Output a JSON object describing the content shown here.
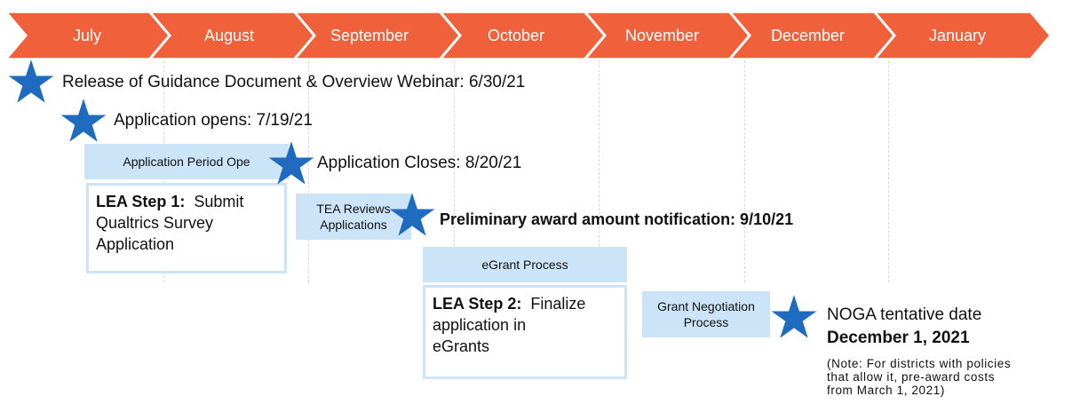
{
  "timeline": {
    "color": "#f0603a",
    "months": [
      "July",
      "August",
      "September",
      "October",
      "November",
      "December",
      "January"
    ]
  },
  "milestones": {
    "guidance_release": "Release of Guidance Document & Overview Webinar: 6/30/21",
    "application_opens": "Application opens: 7/19/21",
    "application_closes": "Application Closes: 8/20/21",
    "preliminary_award": "Preliminary award amount notification: 9/10/21",
    "noga_line1": "NOGA tentative date",
    "noga_line2": "December 1, 2021"
  },
  "phases": {
    "application_period": "Application Period Ope",
    "tea_reviews_line1": "TEA Reviews",
    "tea_reviews_line2": "Applications",
    "egrant_process": "eGrant Process",
    "grant_negotiation_line1": "Grant Negotiation",
    "grant_negotiation_line2": "Process"
  },
  "steps": {
    "step1_label": "LEA Step 1:",
    "step1_text1": "Submit",
    "step1_text2": "Qualtrics Survey",
    "step1_text3": "Application",
    "step2_label": "LEA Step 2:",
    "step2_text1": "Finalize",
    "step2_text2": "application in",
    "step2_text3": "eGrants"
  },
  "note": {
    "line1": "(Note: For districts with policies",
    "line2": "that allow it, pre-award costs",
    "line3": "from March 1, 2021)"
  },
  "colors": {
    "star": "#1f6bbf",
    "phase_fill": "#cce4f7",
    "arrow": "#f0603a"
  }
}
